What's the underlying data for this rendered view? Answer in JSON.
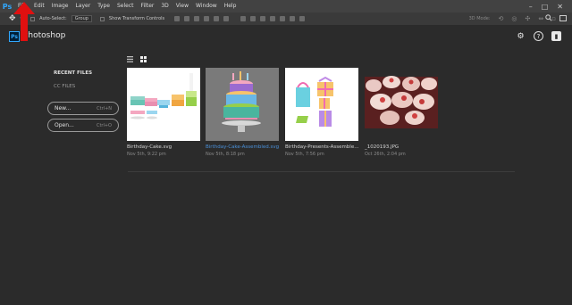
{
  "menubar": {
    "logo": "Ps",
    "items": [
      "File",
      "Edit",
      "Image",
      "Layer",
      "Type",
      "Select",
      "Filter",
      "3D",
      "View",
      "Window",
      "Help"
    ],
    "window_controls": [
      "–",
      "□",
      "✕"
    ]
  },
  "optbar": {
    "auto_select_label": "Auto-Select:",
    "auto_select_value": "Group",
    "transform_label": "Show Transform Controls",
    "mode_label": "3D Mode:"
  },
  "header": {
    "logo": "Ps",
    "title": "Photoshop"
  },
  "sidebar": {
    "recent_label": "RECENT FILES",
    "cc_label": "CC FILES",
    "new_label": "New...",
    "new_shortcut": "Ctrl+N",
    "open_label": "Open...",
    "open_shortcut": "Ctrl+O"
  },
  "files": [
    {
      "name": "Birthday-Cake.svg",
      "date": "Nov 5th, 9:22 pm"
    },
    {
      "name": "Birthday-Cake-Assembled.svg",
      "date": "Nov 5th, 8:18 pm"
    },
    {
      "name": "Birthday-Presents-Assemble...",
      "date": "Nov 5th, 7:56 pm"
    },
    {
      "name": "_1020193.JPG",
      "date": "Oct 26th, 2:04 pm"
    }
  ],
  "colors": {
    "accent": "#31a8ff",
    "selected_text": "#4a90d9",
    "annotation_arrow": "#e01010"
  }
}
